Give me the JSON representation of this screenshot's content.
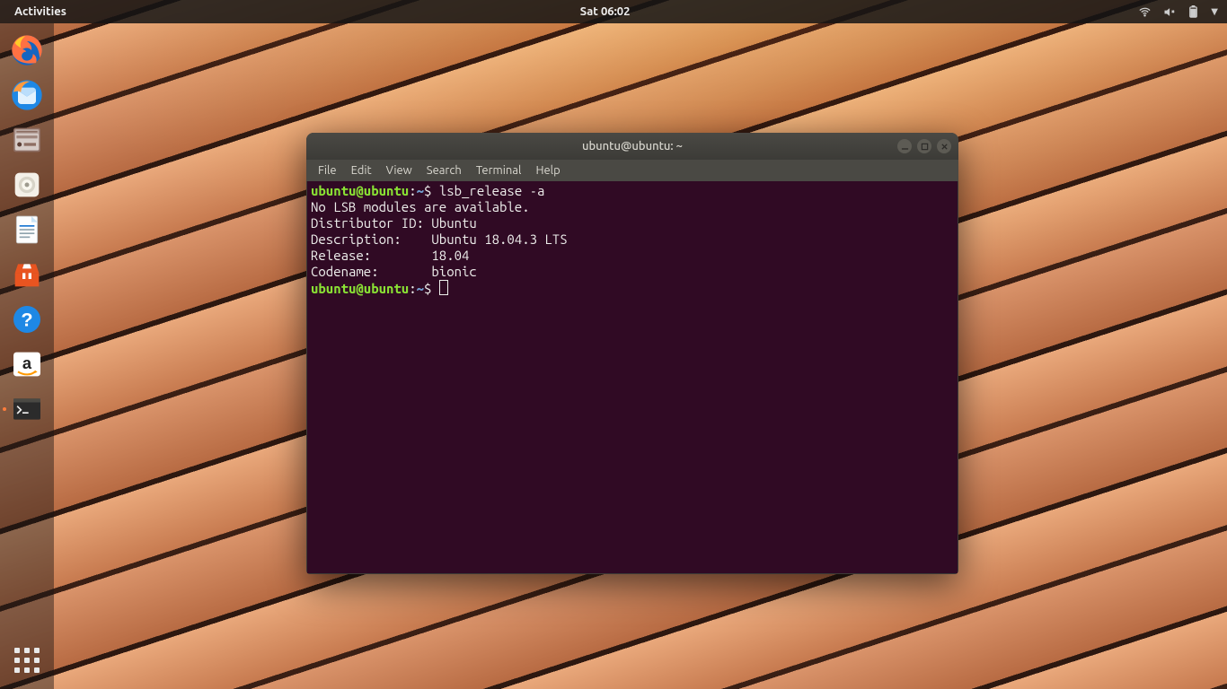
{
  "topbar": {
    "activities": "Activities",
    "clock": "Sat 06:02"
  },
  "dock": {
    "items": [
      {
        "name": "firefox"
      },
      {
        "name": "thunderbird"
      },
      {
        "name": "files"
      },
      {
        "name": "rhythmbox"
      },
      {
        "name": "libreoffice-writer"
      },
      {
        "name": "ubuntu-software"
      },
      {
        "name": "help"
      },
      {
        "name": "amazon"
      },
      {
        "name": "terminal",
        "active": true
      }
    ]
  },
  "window": {
    "title": "ubuntu@ubuntu: ~",
    "menu": [
      "File",
      "Edit",
      "View",
      "Search",
      "Terminal",
      "Help"
    ]
  },
  "terminal": {
    "prompt_user": "ubuntu@ubuntu",
    "prompt_sep1": ":",
    "prompt_path": "~",
    "prompt_sep2": "$ ",
    "command": "lsb_release -a",
    "lines": [
      "No LSB modules are available.",
      "Distributor ID:\tUbuntu",
      "Description:\tUbuntu 18.04.3 LTS",
      "Release:\t18.04",
      "Codename:\tbionic"
    ]
  },
  "colors": {
    "terminal_bg": "#300a24",
    "prompt_green": "#8ae234",
    "prompt_blue": "#729fcf",
    "titlebar_bg": "#3c3b37"
  }
}
